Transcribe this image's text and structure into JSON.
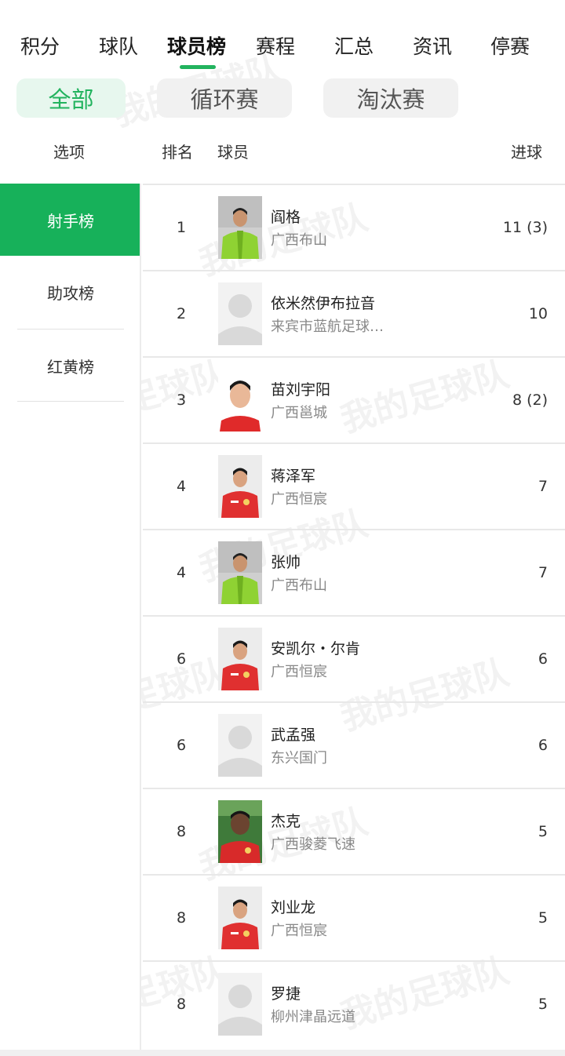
{
  "top_tabs": [
    "积分",
    "球队",
    "球员榜",
    "赛程",
    "汇总",
    "资讯",
    "停赛"
  ],
  "active_tab_index": 2,
  "filters": [
    "全部",
    "循环赛",
    "淘汰赛"
  ],
  "active_filter_index": 0,
  "columns": {
    "options": "选项",
    "rank": "排名",
    "player": "球员",
    "goals": "进球"
  },
  "categories": [
    "射手榜",
    "助攻榜",
    "红黄榜"
  ],
  "active_category_index": 0,
  "watermark": "我的足球队",
  "players": [
    {
      "rank": "1",
      "name": "阎格",
      "team": "广西布山",
      "goals": "11 (3)",
      "avatar": "green-jacket"
    },
    {
      "rank": "2",
      "name": "依米然伊布拉音",
      "team": "来宾市蓝航足球…",
      "goals": "10",
      "avatar": "placeholder"
    },
    {
      "rank": "3",
      "name": "苗刘宇阳",
      "team": "广西邕城",
      "goals": "8 (2)",
      "avatar": "red-shirt"
    },
    {
      "rank": "4",
      "name": "蒋泽军",
      "team": "广西恒宸",
      "goals": "7",
      "avatar": "red-jersey"
    },
    {
      "rank": "4",
      "name": "张帅",
      "team": "广西布山",
      "goals": "7",
      "avatar": "green-jacket"
    },
    {
      "rank": "6",
      "name": "安凯尔・尔肯",
      "team": "广西恒宸",
      "goals": "6",
      "avatar": "red-jersey"
    },
    {
      "rank": "6",
      "name": "武孟强",
      "team": "东兴国门",
      "goals": "6",
      "avatar": "placeholder"
    },
    {
      "rank": "8",
      "name": "杰克",
      "team": "广西骏菱飞速",
      "goals": "5",
      "avatar": "red-outdoor"
    },
    {
      "rank": "8",
      "name": "刘业龙",
      "team": "广西恒宸",
      "goals": "5",
      "avatar": "red-jersey"
    },
    {
      "rank": "8",
      "name": "罗捷",
      "team": "柳州津晶远道",
      "goals": "5",
      "avatar": "placeholder"
    }
  ],
  "colors": {
    "accent": "#22b35e",
    "active_category_bg": "#17b15a",
    "pill_active_bg": "#e7f7ee"
  }
}
